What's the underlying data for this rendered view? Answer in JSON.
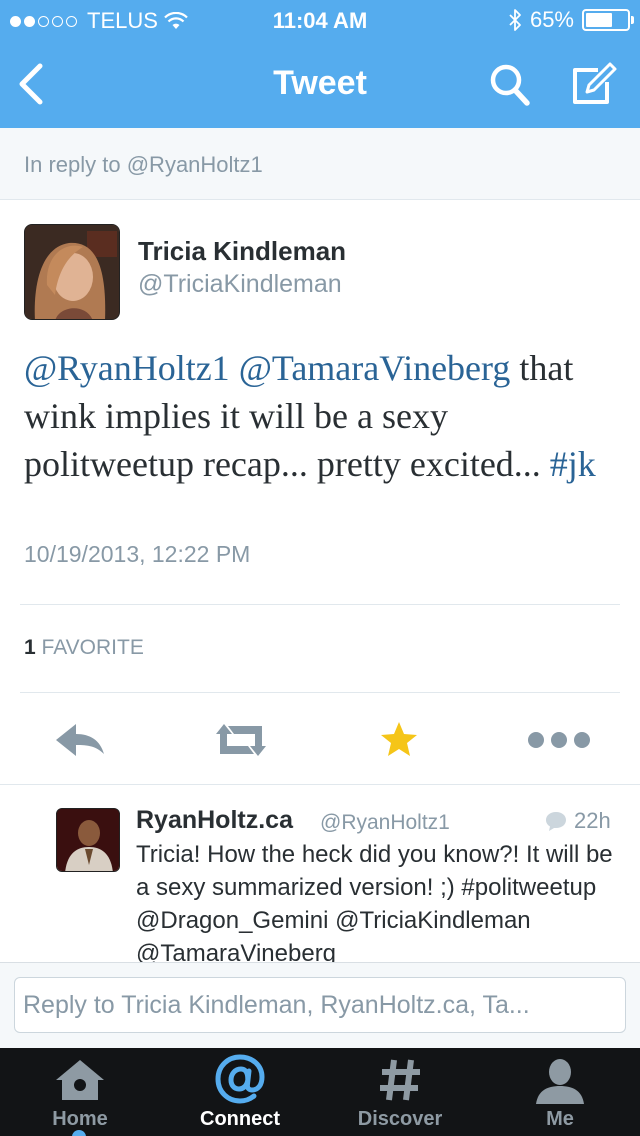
{
  "status_bar": {
    "carrier": "TELUS",
    "time": "11:04 AM",
    "battery": "65%",
    "battery_level": 0.65
  },
  "nav": {
    "title": "Tweet",
    "back_icon": "chevron-left-icon",
    "search_icon": "search-icon",
    "compose_icon": "compose-icon"
  },
  "in_reply": {
    "label": "In reply to @RyanHoltz1"
  },
  "tweet": {
    "author_name": "Tricia Kindleman",
    "author_handle": "@TriciaKindleman",
    "mention1": "@RyanHoltz1",
    "mention2": "@TamaraVineberg",
    "body": "that wink implies it will be a sexy politweetup recap... pretty excited...",
    "hashtag": "#jk",
    "timestamp": "10/19/2013, 12:22 PM",
    "favorite_count": "1",
    "favorite_label": "FAVORITE",
    "colors": {
      "link": "#2a6496",
      "favorite_star": "#f5c518"
    }
  },
  "actions": [
    "reply-icon",
    "retweet-icon",
    "favorite-star-icon",
    "more-dots-icon"
  ],
  "reply": {
    "name": "RyanHoltz.ca",
    "handle": "@RyanHoltz1",
    "time": "22h",
    "text": "Tricia! How the heck did you know?! It will be a sexy summarized version! ;) #politweetup @Dragon_Gemini @TriciaKindleman @TamaraVineberg"
  },
  "composer": {
    "placeholder": "Reply to Tricia Kindleman, RyanHoltz.ca, Ta..."
  },
  "tabs": [
    {
      "label": "Home",
      "icon": "home-icon"
    },
    {
      "label": "Connect",
      "icon": "at-icon"
    },
    {
      "label": "Discover",
      "icon": "hashtag-icon"
    },
    {
      "label": "Me",
      "icon": "person-icon"
    }
  ],
  "theme": {
    "brand_blue": "#55acee",
    "tabbar_bg": "#121416"
  }
}
